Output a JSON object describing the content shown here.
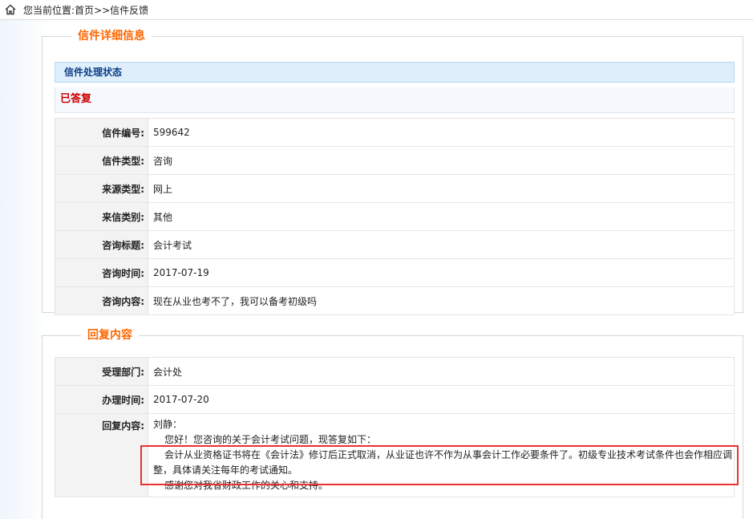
{
  "breadcrumb": {
    "prefix": "您当前位置:",
    "home": "首页",
    "separator": ">>",
    "current": "信件反馈"
  },
  "detail": {
    "legend": "信件详细信息",
    "status_title": "信件处理状态",
    "status_value": "已答复",
    "rows": [
      {
        "label": "信件编号:",
        "value": "599642"
      },
      {
        "label": "信件类型:",
        "value": "咨询"
      },
      {
        "label": "来源类型:",
        "value": "网上"
      },
      {
        "label": "来信类别:",
        "value": "其他"
      },
      {
        "label": "咨询标题:",
        "value": "会计考试"
      },
      {
        "label": "咨询时间:",
        "value": "2017-07-19"
      },
      {
        "label": "咨询内容:",
        "value": "现在从业也考不了，我可以备考初级吗"
      }
    ]
  },
  "reply": {
    "legend": "回复内容",
    "rows": [
      {
        "label": "受理部门:",
        "value": "会计处"
      },
      {
        "label": "办理时间:",
        "value": "2017-07-20"
      },
      {
        "label": "回复内容:"
      }
    ],
    "body": [
      "刘静：",
      "您好！您咨询的关于会计考试问题，现答复如下：",
      "会计从业资格证书将在《会计法》修订后正式取消，从业证也许不作为从事会计工作必要条件了。初级专业技术考试条件也会作相应调",
      "整，具体请关注每年的考试通知。",
      "感谢您对我省财政工作的关心和支持。"
    ]
  },
  "colors": {
    "legend": "#ff6600",
    "status_head_bg": "#dfeefb",
    "status_text": "#cc0000",
    "highlight_border": "#e8322f"
  }
}
